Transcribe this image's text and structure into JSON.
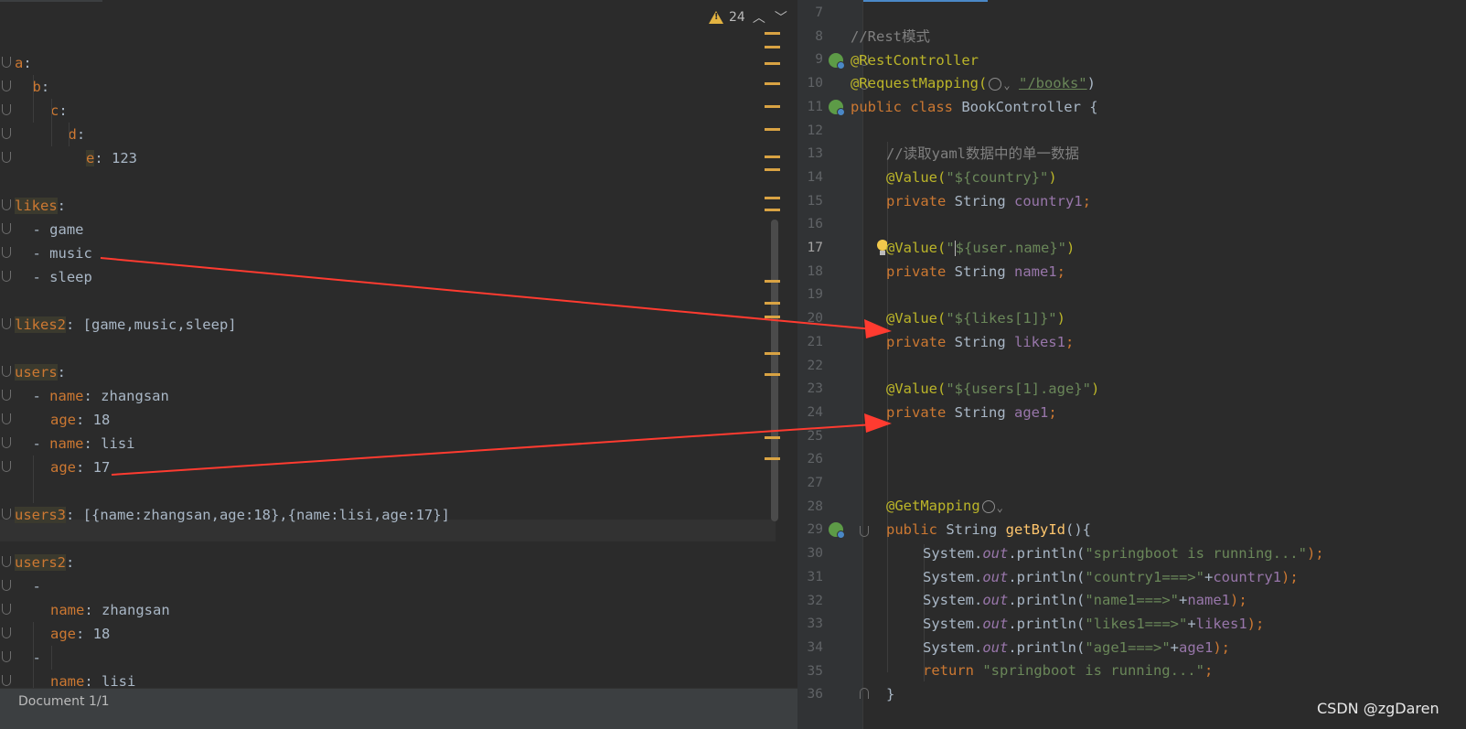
{
  "left_pane": {
    "warnings_count": "24",
    "status": "Document 1/1",
    "yaml_lines": [
      {
        "indent": 0,
        "key": "a",
        "rest": ":"
      },
      {
        "indent": 1,
        "key": "b",
        "rest": ":"
      },
      {
        "indent": 2,
        "key": "c",
        "rest": ":"
      },
      {
        "indent": 3,
        "key": "d",
        "rest": ":"
      },
      {
        "indent": 4,
        "key": "e",
        "rest": ": 123"
      },
      {
        "indent": 0,
        "key": "",
        "rest": ""
      },
      {
        "indent": 0,
        "key": "likes",
        "rest": ":"
      },
      {
        "indent": 1,
        "key": "",
        "rest": "- game"
      },
      {
        "indent": 1,
        "key": "",
        "rest": "- music"
      },
      {
        "indent": 1,
        "key": "",
        "rest": "- sleep"
      },
      {
        "indent": 0,
        "key": "",
        "rest": ""
      },
      {
        "indent": 0,
        "key": "likes2",
        "rest": ": [game,music,sleep]"
      },
      {
        "indent": 0,
        "key": "",
        "rest": ""
      },
      {
        "indent": 0,
        "key": "users",
        "rest": ":"
      },
      {
        "indent": 1,
        "key": "",
        "rest": "- ",
        "key2": "name",
        "rest2": ": zhangsan"
      },
      {
        "indent": 2,
        "key": "age",
        "rest": ": 18"
      },
      {
        "indent": 1,
        "key": "",
        "rest": "- ",
        "key2": "name",
        "rest2": ": lisi"
      },
      {
        "indent": 2,
        "key": "age",
        "rest": ": 17"
      },
      {
        "indent": 0,
        "key": "",
        "rest": ""
      },
      {
        "indent": 0,
        "key": "users3",
        "rest": ": [{name:zhangsan,age:18},{name:lisi,age:17}]"
      },
      {
        "indent": 0,
        "key": "",
        "rest": ""
      },
      {
        "indent": 0,
        "key": "users2",
        "rest": ":"
      },
      {
        "indent": 1,
        "key": "",
        "rest": "-"
      },
      {
        "indent": 2,
        "key": "name",
        "rest": ": zhangsan"
      },
      {
        "indent": 2,
        "key": "age",
        "rest": ": 18"
      },
      {
        "indent": 1,
        "key": "",
        "rest": "-"
      },
      {
        "indent": 2,
        "key": "name",
        "rest": ": lisi"
      }
    ]
  },
  "right_pane": {
    "line_numbers": [
      "7",
      "8",
      "9",
      "10",
      "11",
      "12",
      "13",
      "14",
      "15",
      "16",
      "17",
      "18",
      "19",
      "20",
      "21",
      "22",
      "23",
      "24",
      "25",
      "26",
      "27",
      "28",
      "29",
      "30",
      "31",
      "32",
      "33",
      "34",
      "35",
      "36"
    ],
    "current_line": "17",
    "code": {
      "l8": "//Rest模式",
      "l9": "@RestController",
      "l10_ann": "@RequestMapping(",
      "l10_str": "\"/books\"",
      "l10_end": ")",
      "l11_kw": "public class ",
      "l11_rest": "BookController {",
      "l13": "//读取yaml数据中的单一数据",
      "l14_ann": "@Value(",
      "l14_str": "\"${country}\"",
      "l14_end": ")",
      "l15_kw": "private ",
      "l15_type": "String ",
      "l15_fld": "country1",
      "l15_end": ";",
      "l17_ann": "@Value(",
      "l17_str1": "\"",
      "l17_str2": "${user.name}\"",
      "l17_end": ")",
      "l18_kw": "private ",
      "l18_type": "String ",
      "l18_fld": "name1",
      "l18_end": ";",
      "l20_ann": "@Value(",
      "l20_str": "\"${likes[1]}\"",
      "l20_end": ")",
      "l21_kw": "private ",
      "l21_type": "String ",
      "l21_fld": "likes1",
      "l21_end": ";",
      "l23_ann": "@Value(",
      "l23_str": "\"${users[1].age}\"",
      "l23_end": ")",
      "l24_kw": "private ",
      "l24_type": "String ",
      "l24_fld": "age1",
      "l24_end": ";",
      "l28_ann": "@GetMapping",
      "l29_kw": "public ",
      "l29_type": "String ",
      "l29_meth": "getById",
      "l29_end": "(){",
      "l30_a": "System.",
      "l30_out": "out",
      "l30_b": ".println(",
      "l30_str": "\"springboot is running...\"",
      "l30_end": ");",
      "l31_str": "\"country1===>\"",
      "l31_plus": "+",
      "l31_fld": "country1",
      "l31_end": ");",
      "l32_str": "\"name1===>\"",
      "l32_fld": "name1",
      "l33_str": "\"likes1===>\"",
      "l33_fld": "likes1",
      "l34_str": "\"age1===>\"",
      "l34_fld": "age1",
      "l35_kw": "return ",
      "l35_str": "\"springboot is running...\"",
      "l35_end": ";",
      "l36": "}"
    }
  },
  "watermark": "CSDN @zgDaren",
  "colors": {
    "background": "#2b2b2b",
    "keyword": "#cc7832",
    "string": "#6a8759",
    "annotation": "#bbb529",
    "field": "#9876aa",
    "comment": "#808080",
    "arrow": "#ff3b30"
  },
  "icons": [
    "warning-icon",
    "chevron-up-icon",
    "chevron-down-icon",
    "spring-bean-icon",
    "globe-icon",
    "lightbulb-icon",
    "fold-icon"
  ]
}
